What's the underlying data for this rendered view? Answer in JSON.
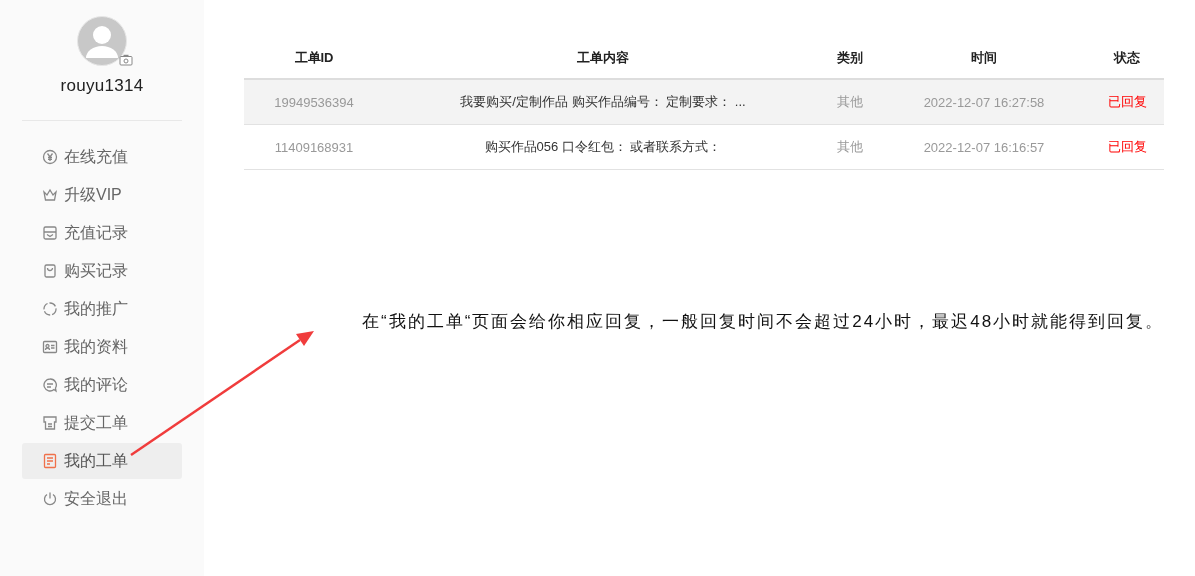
{
  "sidebar": {
    "username": "rouyu1314",
    "items": [
      {
        "kind": "yuan",
        "label": "在线充值",
        "selected": false
      },
      {
        "kind": "crown",
        "label": "升级VIP",
        "selected": false
      },
      {
        "kind": "box",
        "label": "充值记录",
        "selected": false
      },
      {
        "kind": "bag",
        "label": "购买记录",
        "selected": false
      },
      {
        "kind": "circle",
        "label": "我的推广",
        "selected": false
      },
      {
        "kind": "card",
        "label": "我的资料",
        "selected": false
      },
      {
        "kind": "chat",
        "label": "我的评论",
        "selected": false
      },
      {
        "kind": "printer",
        "label": "提交工单",
        "selected": false
      },
      {
        "kind": "doc",
        "label": "我的工单",
        "selected": true
      },
      {
        "kind": "power",
        "label": "安全退出",
        "selected": false
      }
    ]
  },
  "table": {
    "columns": [
      "工单ID",
      "工单内容",
      "类别",
      "时间",
      "状态"
    ],
    "rows": [
      {
        "cells": [
          "19949536394",
          "我要购买/定制作品 购买作品编号： 定制要求： ...",
          "其他",
          "2022-12-07 16:27:58",
          "已回复"
        ],
        "highlighted": true
      },
      {
        "cells": [
          "11409168931",
          "购买作品056 口令红包： 或者联系方式：",
          "其他",
          "2022-12-07 16:16:57",
          "已回复"
        ],
        "highlighted": false
      }
    ]
  },
  "annotation": {
    "text": "在“我的工单“页面会给你相应回复，一般回复时间不会超过24小时，最迟48小时就能得到回复。"
  }
}
